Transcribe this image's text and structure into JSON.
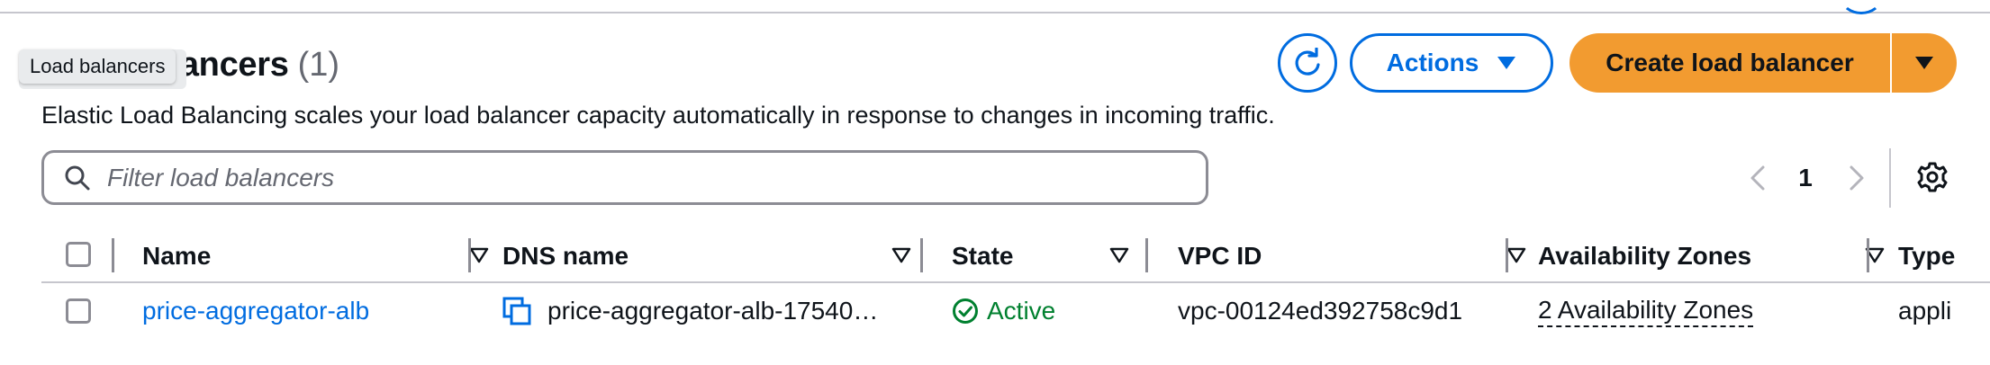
{
  "page": {
    "title": "Load balancers",
    "title_visible": "ancers",
    "count": "(1)",
    "tooltip": "Load balancers",
    "description": "Elastic Load Balancing scales your load balancer capacity automatically in response to changes in incoming traffic."
  },
  "toolbar": {
    "refresh_icon": "refresh-icon",
    "actions_label": "Actions",
    "create_label": "Create load balancer"
  },
  "filter": {
    "placeholder": "Filter load balancers",
    "value": ""
  },
  "pagination": {
    "current_page": "1"
  },
  "table": {
    "columns": [
      {
        "label": "Name"
      },
      {
        "label": "DNS name"
      },
      {
        "label": "State"
      },
      {
        "label": "VPC ID"
      },
      {
        "label": "Availability Zones"
      },
      {
        "label": "Type"
      }
    ],
    "rows": [
      {
        "name": "price-aggregator-alb",
        "dns_name": "price-aggregator-alb-17540…",
        "state": "Active",
        "vpc_id": "vpc-00124ed392758c9d1",
        "availability_zones": "2 Availability Zones",
        "type": "appli"
      }
    ]
  },
  "colors": {
    "accent": "#006ce0",
    "primary_button": "#f29b30",
    "success": "#00802f",
    "border": "#8c8c94"
  }
}
